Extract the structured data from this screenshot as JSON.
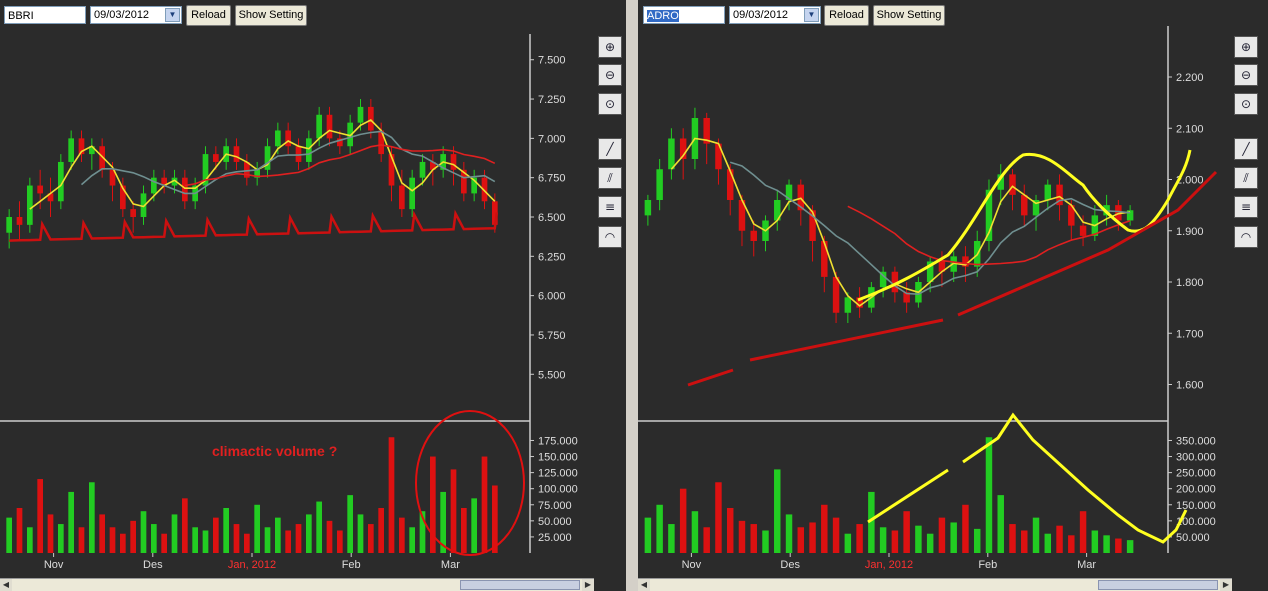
{
  "toolbar_common": {
    "reload_label": "Reload",
    "show_setting_label": "Show Setting"
  },
  "left": {
    "ticker": "BBRI",
    "date": "09/03/2012",
    "price_ticks": [
      "7.500",
      "7.250",
      "7.000",
      "6.750",
      "6.500",
      "6.250",
      "6.000",
      "5.750",
      "5.500"
    ],
    "volume_ticks": [
      "175.000",
      "150.000",
      "125.000",
      "100.000",
      "75.000",
      "50.000",
      "25.000"
    ],
    "month_labels": [
      "Nov",
      "Des",
      "Jan, 2012",
      "Feb",
      "Mar"
    ],
    "annotation": "climactic volume ?"
  },
  "right": {
    "ticker": "ADRO",
    "date": "09/03/2012",
    "price_ticks": [
      "2.200",
      "2.100",
      "2.000",
      "1.900",
      "1.800",
      "1.700",
      "1.600"
    ],
    "volume_ticks": [
      "350.000",
      "300.000",
      "250.000",
      "200.000",
      "150.000",
      "100.000",
      "50.000"
    ],
    "month_labels": [
      "Nov",
      "Des",
      "Jan, 2012",
      "Feb",
      "Mar"
    ]
  },
  "colors": {
    "up": "#22cc22",
    "down": "#dd1111",
    "ma_fast": "#f0e030",
    "ma_mid": "#6f8f90",
    "ma_slow": "#e02020",
    "drawing_yellow": "#ffff20",
    "drawing_red": "#cc1010"
  },
  "chart_data": [
    {
      "type": "candlestick",
      "title": "BBRI",
      "x_ticks": [
        "Nov",
        "Des",
        "Jan, 2012",
        "Feb",
        "Mar"
      ],
      "ylim": [
        5.4,
        7.6
      ],
      "y_ticks": [
        7.5,
        7.25,
        7.0,
        6.75,
        6.5,
        6.25,
        6.0,
        5.75,
        5.5
      ],
      "candles": [
        [
          6.4,
          6.5,
          6.3,
          6.55
        ],
        [
          6.5,
          6.45,
          6.35,
          6.6
        ],
        [
          6.45,
          6.7,
          6.4,
          6.75
        ],
        [
          6.7,
          6.65,
          6.55,
          6.8
        ],
        [
          6.65,
          6.6,
          6.5,
          6.75
        ],
        [
          6.6,
          6.85,
          6.55,
          6.9
        ],
        [
          6.85,
          7.0,
          6.8,
          7.05
        ],
        [
          7.0,
          6.9,
          6.85,
          7.05
        ],
        [
          6.9,
          6.95,
          6.8,
          7.0
        ],
        [
          6.95,
          6.8,
          6.75,
          7.0
        ],
        [
          6.8,
          6.7,
          6.6,
          6.85
        ],
        [
          6.7,
          6.55,
          6.5,
          6.75
        ],
        [
          6.55,
          6.5,
          6.4,
          6.6
        ],
        [
          6.5,
          6.65,
          6.45,
          6.7
        ],
        [
          6.65,
          6.75,
          6.6,
          6.8
        ],
        [
          6.75,
          6.7,
          6.65,
          6.8
        ],
        [
          6.7,
          6.75,
          6.65,
          6.8
        ],
        [
          6.75,
          6.6,
          6.55,
          6.8
        ],
        [
          6.6,
          6.7,
          6.55,
          6.75
        ],
        [
          6.7,
          6.9,
          6.65,
          6.95
        ],
        [
          6.9,
          6.85,
          6.8,
          6.95
        ],
        [
          6.85,
          6.95,
          6.8,
          7.0
        ],
        [
          6.95,
          6.85,
          6.8,
          7.0
        ],
        [
          6.85,
          6.75,
          6.7,
          6.9
        ],
        [
          6.75,
          6.8,
          6.7,
          6.85
        ],
        [
          6.8,
          6.95,
          6.75,
          7.0
        ],
        [
          6.95,
          7.05,
          6.9,
          7.1
        ],
        [
          7.05,
          6.95,
          6.9,
          7.1
        ],
        [
          6.95,
          6.85,
          6.8,
          7.0
        ],
        [
          6.85,
          7.0,
          6.8,
          7.05
        ],
        [
          7.0,
          7.15,
          6.95,
          7.2
        ],
        [
          7.15,
          7.0,
          6.95,
          7.2
        ],
        [
          7.0,
          6.95,
          6.9,
          7.05
        ],
        [
          6.95,
          7.1,
          6.9,
          7.15
        ],
        [
          7.1,
          7.2,
          7.05,
          7.25
        ],
        [
          7.2,
          7.05,
          7.0,
          7.25
        ],
        [
          7.05,
          6.9,
          6.85,
          7.1
        ],
        [
          6.9,
          6.7,
          6.6,
          6.95
        ],
        [
          6.7,
          6.55,
          6.5,
          6.8
        ],
        [
          6.55,
          6.75,
          6.5,
          6.8
        ],
        [
          6.75,
          6.85,
          6.7,
          6.9
        ],
        [
          6.85,
          6.8,
          6.7,
          6.9
        ],
        [
          6.8,
          6.9,
          6.75,
          6.95
        ],
        [
          6.9,
          6.8,
          6.7,
          6.95
        ],
        [
          6.8,
          6.65,
          6.6,
          6.85
        ],
        [
          6.65,
          6.75,
          6.6,
          6.8
        ],
        [
          6.75,
          6.6,
          6.55,
          6.8
        ],
        [
          6.6,
          6.45,
          6.4,
          6.65
        ]
      ],
      "volume": [
        55,
        70,
        40,
        115,
        60,
        45,
        95,
        40,
        110,
        60,
        40,
        30,
        50,
        65,
        45,
        30,
        60,
        85,
        40,
        35,
        55,
        70,
        45,
        30,
        75,
        40,
        55,
        35,
        45,
        60,
        80,
        50,
        35,
        90,
        60,
        45,
        70,
        180,
        55,
        40,
        65,
        150,
        95,
        130,
        70,
        85,
        150,
        105
      ]
    },
    {
      "type": "candlestick",
      "title": "ADRO",
      "x_ticks": [
        "Nov",
        "Des",
        "Jan, 2012",
        "Feb",
        "Mar"
      ],
      "ylim": [
        1.56,
        2.28
      ],
      "y_ticks": [
        2.2,
        2.1,
        2.0,
        1.9,
        1.8,
        1.7,
        1.6
      ],
      "candles": [
        [
          1.93,
          1.96,
          1.91,
          1.97
        ],
        [
          1.96,
          2.02,
          1.94,
          2.04
        ],
        [
          2.02,
          2.08,
          2.0,
          2.1
        ],
        [
          2.08,
          2.04,
          2.0,
          2.1
        ],
        [
          2.04,
          2.12,
          2.02,
          2.14
        ],
        [
          2.12,
          2.07,
          2.03,
          2.13
        ],
        [
          2.07,
          2.02,
          1.99,
          2.08
        ],
        [
          2.02,
          1.96,
          1.93,
          2.03
        ],
        [
          1.96,
          1.9,
          1.87,
          1.97
        ],
        [
          1.9,
          1.88,
          1.85,
          1.92
        ],
        [
          1.88,
          1.92,
          1.86,
          1.93
        ],
        [
          1.92,
          1.96,
          1.9,
          1.98
        ],
        [
          1.96,
          1.99,
          1.94,
          2.0
        ],
        [
          1.99,
          1.94,
          1.91,
          2.0
        ],
        [
          1.94,
          1.88,
          1.84,
          1.95
        ],
        [
          1.88,
          1.81,
          1.78,
          1.89
        ],
        [
          1.81,
          1.74,
          1.72,
          1.82
        ],
        [
          1.74,
          1.77,
          1.72,
          1.78
        ],
        [
          1.77,
          1.75,
          1.73,
          1.79
        ],
        [
          1.75,
          1.79,
          1.74,
          1.8
        ],
        [
          1.79,
          1.82,
          1.77,
          1.83
        ],
        [
          1.82,
          1.78,
          1.76,
          1.83
        ],
        [
          1.78,
          1.76,
          1.74,
          1.8
        ],
        [
          1.76,
          1.8,
          1.75,
          1.81
        ],
        [
          1.8,
          1.84,
          1.78,
          1.85
        ],
        [
          1.84,
          1.82,
          1.79,
          1.86
        ],
        [
          1.82,
          1.85,
          1.8,
          1.86
        ],
        [
          1.85,
          1.83,
          1.8,
          1.87
        ],
        [
          1.83,
          1.88,
          1.81,
          1.9
        ],
        [
          1.88,
          1.98,
          1.86,
          2.0
        ],
        [
          1.98,
          2.01,
          1.95,
          2.03
        ],
        [
          2.01,
          1.97,
          1.94,
          2.02
        ],
        [
          1.97,
          1.93,
          1.91,
          1.99
        ],
        [
          1.93,
          1.96,
          1.9,
          1.97
        ],
        [
          1.96,
          1.99,
          1.94,
          2.0
        ],
        [
          1.99,
          1.95,
          1.92,
          2.01
        ],
        [
          1.95,
          1.91,
          1.88,
          1.96
        ],
        [
          1.91,
          1.89,
          1.87,
          1.93
        ],
        [
          1.89,
          1.93,
          1.88,
          1.95
        ],
        [
          1.93,
          1.95,
          1.91,
          1.97
        ],
        [
          1.95,
          1.92,
          1.9,
          1.96
        ],
        [
          1.92,
          1.94,
          1.91,
          1.95
        ]
      ],
      "volume": [
        110,
        150,
        90,
        200,
        130,
        80,
        220,
        140,
        100,
        90,
        70,
        260,
        120,
        80,
        95,
        150,
        110,
        60,
        90,
        190,
        80,
        70,
        130,
        85,
        60,
        110,
        95,
        150,
        75,
        360,
        180,
        90,
        70,
        110,
        60,
        85,
        55,
        130,
        70,
        55,
        45,
        40
      ]
    }
  ]
}
